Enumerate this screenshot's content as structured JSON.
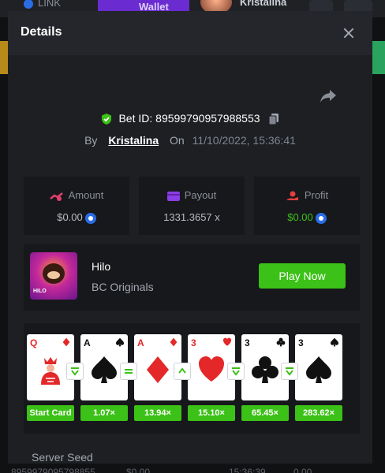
{
  "background": {
    "link_label": "LINK",
    "wallet_label": "Wallet",
    "username": "Kristalina",
    "bottom_left": "8959979095798855",
    "bottom_mid": "$0.00",
    "bottom_time": "15:36:39",
    "bottom_right": "0.00"
  },
  "modal": {
    "title": "Details",
    "bet_id_label": "Bet ID:",
    "bet_id": "8959979095798855​3",
    "by_label": "By",
    "username": "Kristalina",
    "on_label": "On",
    "date": "11/10/2022, 15:36:41"
  },
  "stats": {
    "amount_label": "Amount",
    "amount_value": "$0.00",
    "payout_label": "Payout",
    "payout_value": "1331.3657 x",
    "profit_label": "Profit",
    "profit_value": "$0.00"
  },
  "game": {
    "name": "Hilo",
    "provider": "BC Originals",
    "thumb_tag": "HILO",
    "play_label": "Play Now"
  },
  "cards": [
    {
      "rank": "Q",
      "suit": "diamond",
      "color": "red",
      "badge": "Start Card"
    },
    {
      "rank": "A",
      "suit": "spade",
      "color": "black",
      "badge": "1.07×"
    },
    {
      "rank": "A",
      "suit": "diamond",
      "color": "red",
      "badge": "13.94×"
    },
    {
      "rank": "3",
      "suit": "heart",
      "color": "red",
      "badge": "15.10×"
    },
    {
      "rank": "3",
      "suit": "club",
      "color": "black",
      "badge": "65.45×"
    },
    {
      "rank": "3",
      "suit": "spade",
      "color": "black",
      "badge": "283.62×"
    }
  ],
  "arrows": [
    "lower-or-same",
    "same",
    "higher",
    "lower-or-same",
    "lower-or-same"
  ],
  "server_seed_label": "Server Seed",
  "colors": {
    "accent_green": "#3bc117",
    "modal_bg": "#1d1f23",
    "panel_bg": "#17181b",
    "coin_blue": "#2a6ce6"
  }
}
